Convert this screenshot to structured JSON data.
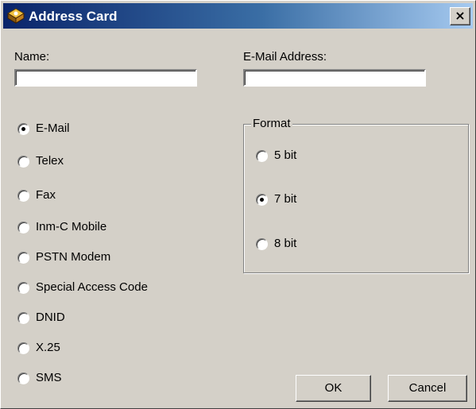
{
  "window": {
    "title": "Address Card",
    "close_label": "×"
  },
  "fields": {
    "name_label": "Name:",
    "name_value": "",
    "email_label": "E-Mail Address:",
    "email_value": ""
  },
  "services": {
    "selected": "E-Mail",
    "options": [
      "E-Mail",
      "Telex",
      "Fax",
      "Inm-C Mobile",
      "PSTN Modem",
      "Special Access Code",
      "DNID",
      "X.25",
      "SMS"
    ]
  },
  "format": {
    "title": "Format",
    "selected": "7 bit",
    "options": [
      "5 bit",
      "7 bit",
      "8 bit"
    ]
  },
  "buttons": {
    "ok_label": "OK",
    "cancel_label": "Cancel"
  },
  "colors": {
    "title_gradient_start": "#0a246a",
    "title_gradient_end": "#a6caf0",
    "dialog_face": "#d4d0c8"
  }
}
